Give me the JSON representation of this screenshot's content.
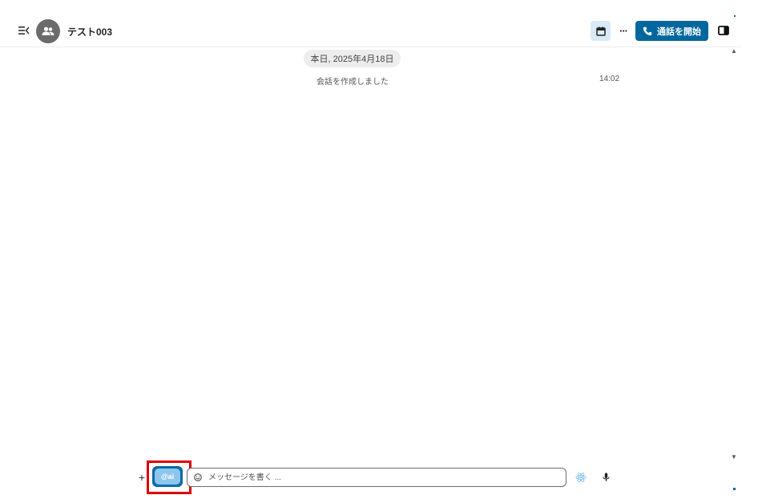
{
  "header": {
    "conversation_title": "テスト003",
    "call_button_label": "通話を開始",
    "more_label": "···"
  },
  "icons": {
    "collapse": "collapse-sidebar-icon",
    "avatar": "group-icon",
    "calendar": "calendar-icon",
    "more": "more-icon",
    "phone": "phone-icon",
    "sidebar": "sidebar-toggle-icon",
    "emoji": "emoji-icon",
    "assistant": "atom-icon",
    "mic": "microphone-icon"
  },
  "chat": {
    "date_separator": "本日, 2025年4月18日",
    "system_message": "会話を作成しました",
    "system_message_time": "14:02"
  },
  "composer": {
    "add_label": "+",
    "ai_button_label": "@ai",
    "placeholder": "メッセージを書く ..."
  },
  "colors": {
    "primary": "#00679e",
    "ai_button_fill": "#8cc6ee",
    "highlight_border": "#e00000",
    "calendar_button_bg": "#dbe9f6"
  }
}
